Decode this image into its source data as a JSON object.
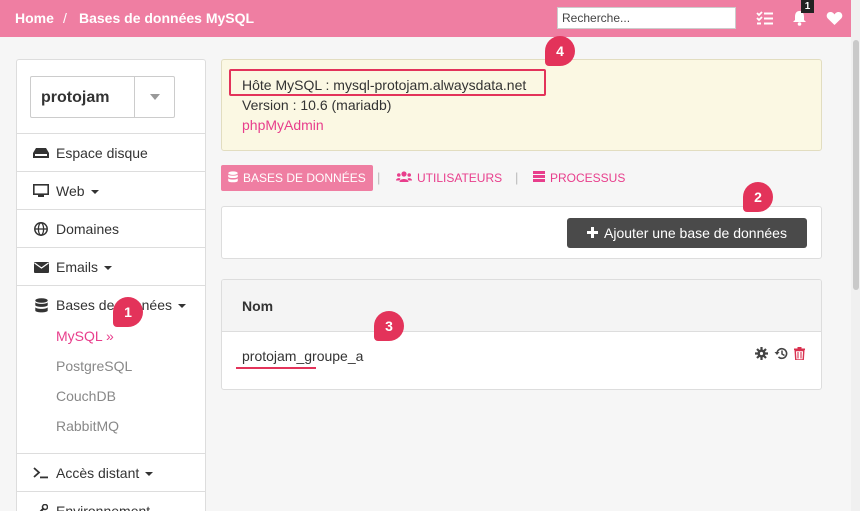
{
  "topbar": {
    "breadcrumb_home": "Home",
    "breadcrumb_sep": "/",
    "breadcrumb_current": "Bases de données MySQL",
    "search_placeholder": "Recherche...",
    "notification_count": "1",
    "color": "#ef7ea2"
  },
  "sidebar": {
    "account_select_value": "protojam",
    "items": [
      {
        "label": "Espace disque",
        "icon": "hdd-icon"
      },
      {
        "label": "Web",
        "icon": "monitor-icon",
        "has_caret": true
      },
      {
        "label": "Domaines",
        "icon": "globe-icon"
      },
      {
        "label": "Emails",
        "icon": "envelope-icon",
        "has_caret": true
      },
      {
        "label": "Bases de données",
        "icon": "database-icon",
        "has_caret": true
      },
      {
        "label": "Accès distant",
        "icon": "terminal-icon",
        "has_caret": true
      },
      {
        "label": "Environnement",
        "icon": "wrench-icon"
      }
    ],
    "db_subitems": [
      "MySQL »",
      "PostgreSQL",
      "CouchDB",
      "RabbitMQ"
    ]
  },
  "info": {
    "host_line": "Hôte MySQL : mysql-protojam.alwaysdata.net",
    "version_line": "Version : 10.6 (mariadb)",
    "phpmyadmin_link": "phpMyAdmin"
  },
  "tabs": [
    {
      "label": "BASES DE DONNÉES",
      "icon": "database-icon",
      "active": true
    },
    {
      "label": "UTILISATEURS",
      "icon": "users-icon",
      "active": false
    },
    {
      "label": "PROCESSUS",
      "icon": "server-icon",
      "active": false
    }
  ],
  "tab_separator": "|",
  "add_button_label": "Ajouter une base de données",
  "table": {
    "header_name": "Nom",
    "rows": [
      {
        "name": "protojam_groupe_a"
      }
    ]
  },
  "callouts": [
    "1",
    "2",
    "3",
    "4"
  ],
  "accent_color": "#e83e8c",
  "callout_color": "#e3335a"
}
